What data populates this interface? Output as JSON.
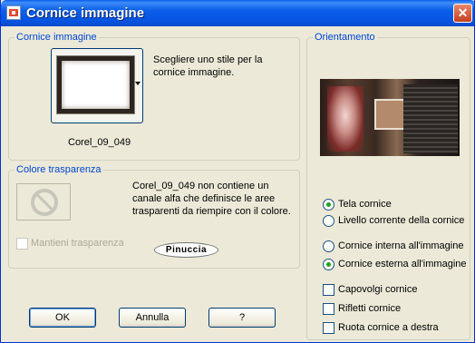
{
  "window": {
    "title": "Cornice immagine",
    "close_glyph": "✕",
    "icon": "image-frame-icon"
  },
  "frame_group": {
    "legend": "Cornice immagine",
    "instruction_line1": "Scegliere uno stile per la",
    "instruction_line2": "cornice immagine.",
    "selected_frame": "Corel_09_049"
  },
  "transparency_group": {
    "legend": "Colore trasparenza",
    "message_line1": "Corel_09_049 non contiene un",
    "message_line2": "canale alfa che definisce le aree",
    "message_line3": "trasparenti da riempire con il colore.",
    "keep_transparency_label": "Mantieni trasparenza",
    "keep_transparency_checked": false,
    "keep_transparency_enabled": false
  },
  "watermark": "Pinuccia",
  "orientation_group": {
    "legend": "Orientamento",
    "options_set1": [
      {
        "label": "Tela cornice",
        "selected": true
      },
      {
        "label": "Livello corrente della cornice",
        "selected": false
      }
    ],
    "options_set2": [
      {
        "label": "Cornice interna all'immagine",
        "selected": false
      },
      {
        "label": "Cornice esterna all'immagine",
        "selected": true
      }
    ],
    "checkboxes": [
      {
        "label": "Capovolgi cornice",
        "checked": false
      },
      {
        "label": "Rifletti cornice",
        "checked": false
      },
      {
        "label": "Ruota cornice a destra",
        "checked": false
      }
    ]
  },
  "buttons": {
    "ok": "OK",
    "cancel": "Annulla",
    "help": "?"
  },
  "colors": {
    "titlebar": "#0a5ee8",
    "dialog_bg": "#ece9d8",
    "group_legend": "#0046d5",
    "radio_dot": "#21a121"
  }
}
